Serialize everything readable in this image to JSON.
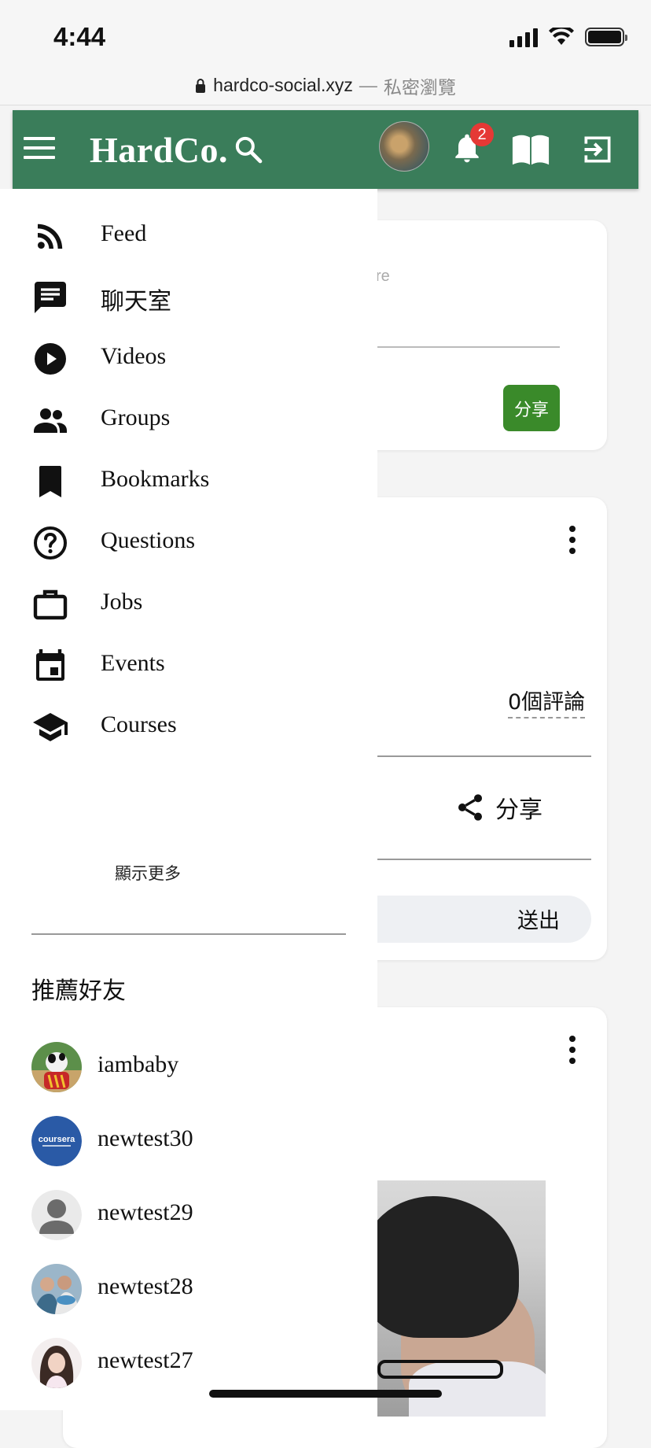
{
  "status_bar": {
    "time": "4:44"
  },
  "url_bar": {
    "host": "hardco-social.xyz",
    "separator": "—",
    "mode": "私密瀏覽"
  },
  "header": {
    "brand": "HardCo.",
    "notification_count": "2",
    "accent_color": "#3a7d5a"
  },
  "drawer": {
    "nav_items": [
      {
        "label": "Feed",
        "icon": "rss-icon"
      },
      {
        "label": "聊天室",
        "icon": "chat-icon"
      },
      {
        "label": "Videos",
        "icon": "play-circle-icon"
      },
      {
        "label": "Groups",
        "icon": "group-icon"
      },
      {
        "label": "Bookmarks",
        "icon": "bookmark-icon"
      },
      {
        "label": "Questions",
        "icon": "question-circle-icon"
      },
      {
        "label": "Jobs",
        "icon": "briefcase-icon"
      },
      {
        "label": "Events",
        "icon": "calendar-icon"
      },
      {
        "label": "Courses",
        "icon": "graduation-cap-icon"
      }
    ],
    "show_more": "顯示更多",
    "recommend_title": "推薦好友",
    "friends": [
      {
        "name": "iambaby"
      },
      {
        "name": "newtest30"
      },
      {
        "name": "newtest29"
      },
      {
        "name": "newtest28"
      },
      {
        "name": "newtest27"
      }
    ]
  },
  "composer": {
    "placeholder_fragment": "re",
    "share_button": "分享"
  },
  "feed": {
    "comment_count": "0個評論",
    "share_label": "分享",
    "send_button": "送出"
  }
}
